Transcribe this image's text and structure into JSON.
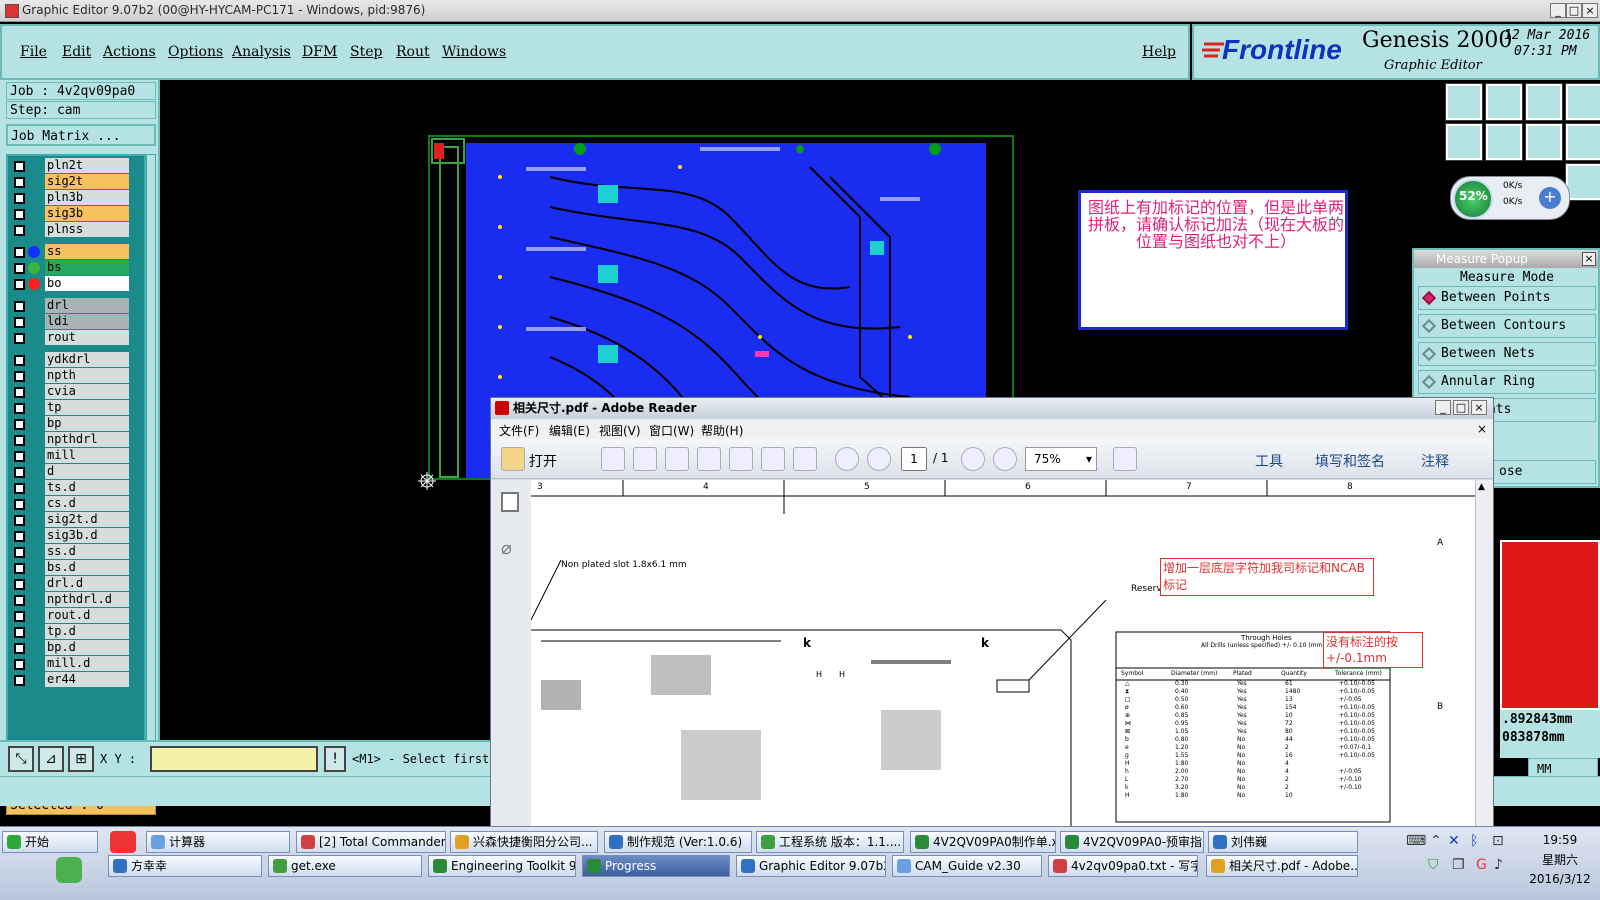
{
  "window": {
    "title": "Graphic Editor 9.07b2 (00@HY-HYCAM-PC171 - Windows, pid:9876)"
  },
  "menu": {
    "items": [
      "File",
      "Edit",
      "Actions",
      "Options",
      "Analysis",
      "DFM",
      "Step",
      "Rout",
      "Windows"
    ],
    "help": "Help"
  },
  "brand": {
    "logo": "Frontline",
    "product": "Genesis 2000",
    "subtitle": "Graphic Editor",
    "date": "12 Mar 2016",
    "time": "07:31 PM"
  },
  "job": {
    "job_label": "Job : 4v2qv09pa0",
    "step_label": "Step: cam",
    "matrix_button": "Job Matrix ..."
  },
  "layers": [
    {
      "name": "pln2t",
      "color": "#d7dcdc"
    },
    {
      "name": "sig2t",
      "color": "#f4c15c"
    },
    {
      "name": "pln3b",
      "color": "#d7dcdc"
    },
    {
      "name": "sig3b",
      "color": "#f4c15c"
    },
    {
      "name": "plnss",
      "color": "#d7dcdc"
    },
    {
      "name": "ss",
      "color": "#f4c15c",
      "dot": "#1030ff"
    },
    {
      "name": "bs",
      "color": "#23a860",
      "dot": "#3cb43c"
    },
    {
      "name": "bo",
      "color": "#ffffff",
      "dot": "#ff2020"
    },
    {
      "name": "drl",
      "color": "#aab3b3"
    },
    {
      "name": "ldi",
      "color": "#aab3b3"
    },
    {
      "name": "rout",
      "color": "#d7dcdc"
    },
    {
      "name": "ydkdrl",
      "color": "#d7dcdc"
    },
    {
      "name": "npth",
      "color": "#d7dcdc"
    },
    {
      "name": "cvia",
      "color": "#d7dcdc"
    },
    {
      "name": "tp",
      "color": "#d7dcdc"
    },
    {
      "name": "bp",
      "color": "#d7dcdc"
    },
    {
      "name": "npthdrl",
      "color": "#d7dcdc"
    },
    {
      "name": "mill",
      "color": "#d7dcdc"
    },
    {
      "name": "d",
      "color": "#d7dcdc"
    },
    {
      "name": "ts.d",
      "color": "#d7dcdc"
    },
    {
      "name": "cs.d",
      "color": "#d7dcdc"
    },
    {
      "name": "sig2t.d",
      "color": "#d7dcdc"
    },
    {
      "name": "sig3b.d",
      "color": "#d7dcdc"
    },
    {
      "name": "ss.d",
      "color": "#d7dcdc"
    },
    {
      "name": "bs.d",
      "color": "#d7dcdc"
    },
    {
      "name": "drl.d",
      "color": "#d7dcdc"
    },
    {
      "name": "npthdrl.d",
      "color": "#d7dcdc"
    },
    {
      "name": "rout.d",
      "color": "#d7dcdc"
    },
    {
      "name": "tp.d",
      "color": "#d7dcdc"
    },
    {
      "name": "bp.d",
      "color": "#d7dcdc"
    },
    {
      "name": "mill.d",
      "color": "#d7dcdc"
    },
    {
      "name": "er44",
      "color": "#d7dcdc"
    }
  ],
  "selected": "Selected : 0",
  "status": {
    "xy_label": "X Y :",
    "xy_value": "",
    "prompt": "<M1> - Select first"
  },
  "note": {
    "text": "图纸上有加标记的位置，但是此单两拼板，请确认标记加法（现在大板的位置与图纸也对不上）"
  },
  "speed": {
    "percent": "52%",
    "up": "0K/s",
    "down": "0K/s"
  },
  "measure": {
    "title": "Measure Popup",
    "mode": "Measure Mode",
    "options": [
      "Between Points",
      "Between Contours",
      "Between Nets",
      "Annular Ring",
      "Midpoints"
    ],
    "close": "ose",
    "coord1": ".892843mm",
    "coord2": "083878mm",
    "unit": "MM"
  },
  "reader": {
    "title": "相关尺寸.pdf - Adobe Reader",
    "menu": [
      "文件(F)",
      "编辑(E)",
      "视图(V)",
      "窗口(W)",
      "帮助(H)"
    ],
    "open": "打开",
    "page": "1",
    "pages": "/ 1",
    "zoom": "75%",
    "tools": "工具",
    "sign": "填写和签名",
    "comment": "注释",
    "columns": [
      "3",
      "4",
      "5",
      "6",
      "7",
      "8"
    ],
    "rowA": "A",
    "rowB": "B",
    "slot_note": "Non plated slot 1.8x6.1 mm",
    "ul_note": "Reserved area for UL markings",
    "red_note1": "增加一层底层字符加我司标记和NCAB标记",
    "red_note2": "没有标注的按+/-0.1mm",
    "table_title": "Through Holes",
    "table_sub": "All Drills (unless specified) +/- 0.10 (mm)",
    "table_headers": [
      "Symbol",
      "Diameter (mm)",
      "Plated",
      "Quantity",
      "Tolerance (mm)"
    ],
    "table_rows": [
      [
        "△",
        "0.30",
        "Yes",
        "61",
        "+0.10/-0.05"
      ],
      [
        "⧗",
        "0.40",
        "Yes",
        "1480",
        "+0.10/-0.05"
      ],
      [
        "□",
        "0.50",
        "Yes",
        "13",
        "+/-0.05"
      ],
      [
        "ø",
        "0.60",
        "Yes",
        "154",
        "+0.10/-0.05"
      ],
      [
        "⊕",
        "0.85",
        "Yes",
        "10",
        "+0.10/-0.05"
      ],
      [
        "⋈",
        "0.95",
        "Yes",
        "72",
        "+0.10/-0.05"
      ],
      [
        "⊠",
        "1.05",
        "Yes",
        "80",
        "+0.10/-0.05"
      ],
      [
        "b",
        "0.80",
        "No",
        "44",
        "+0.10/-0.05"
      ],
      [
        "e",
        "1.20",
        "No",
        "2",
        "+0.07/-0.1"
      ],
      [
        "g",
        "1.55",
        "No",
        "16",
        "+0.10/-0.05"
      ],
      [
        "H",
        "1.80",
        "No",
        "4",
        ""
      ],
      [
        "h",
        "2.00",
        "No",
        "4",
        "+/-0.05"
      ],
      [
        "L",
        "2.70",
        "No",
        "2",
        "+/-0.10"
      ],
      [
        "k",
        "3.20",
        "No",
        "2",
        "+/-0.10"
      ],
      [
        "H",
        "1.80",
        "No",
        "10",
        ""
      ]
    ],
    "k_marks": [
      "k",
      "k"
    ],
    "h_marks": [
      "H",
      "H"
    ]
  },
  "taskbar": {
    "start": "开始",
    "row1": [
      "计算器",
      "[2] Total Commander 7....",
      "兴森快捷衡阳分公司...",
      "制作规范 (Ver:1.0.6)",
      "工程系统  版本：1.1....",
      "4V2QV09PA0制作单.xl...",
      "4V2QV09PA0-预审指...",
      "刘伟巍"
    ],
    "row2": [
      "方幸幸",
      "get.exe",
      "Engineering Toolkit 9.07...",
      "Progress",
      "Graphic Editor 9.07b2 (0...",
      "CAM_Guide v2.30",
      "4v2qv09pa0.txt - 写字板",
      "相关尺寸.pdf - Adobe..."
    ],
    "time": "19:59",
    "weekday": "星期六",
    "date": "2016/3/12"
  }
}
